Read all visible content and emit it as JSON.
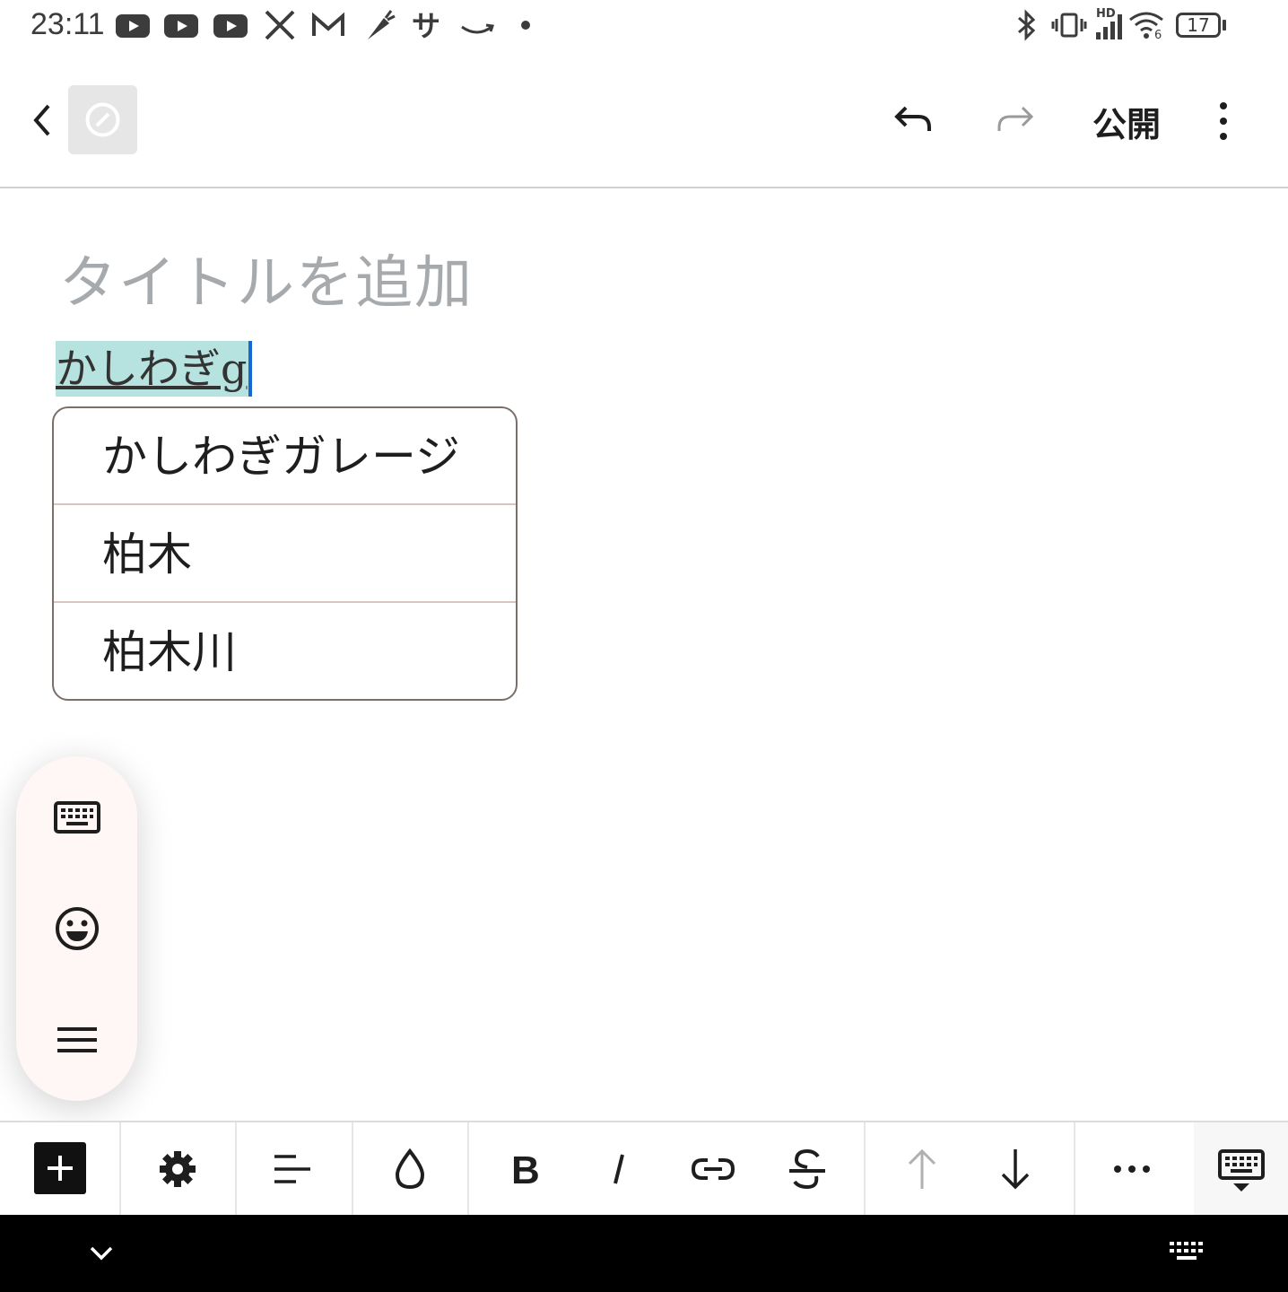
{
  "status_bar": {
    "time": "23:11",
    "battery": "17",
    "network_badge": "HD",
    "wifi_badge": "6"
  },
  "toolbar": {
    "publish_label": "公開"
  },
  "editor": {
    "title_placeholder": "タイトルを追加",
    "composing_text": "かしわぎg"
  },
  "suggestions": [
    "かしわぎガレージ",
    "柏木",
    "柏木川"
  ],
  "colors": {
    "highlight": "#b6e3df",
    "cursor": "#1967d2",
    "popup_border": "#7b6f6b",
    "floating_bg": "#fff7f5",
    "nav_bar": "#000000"
  }
}
